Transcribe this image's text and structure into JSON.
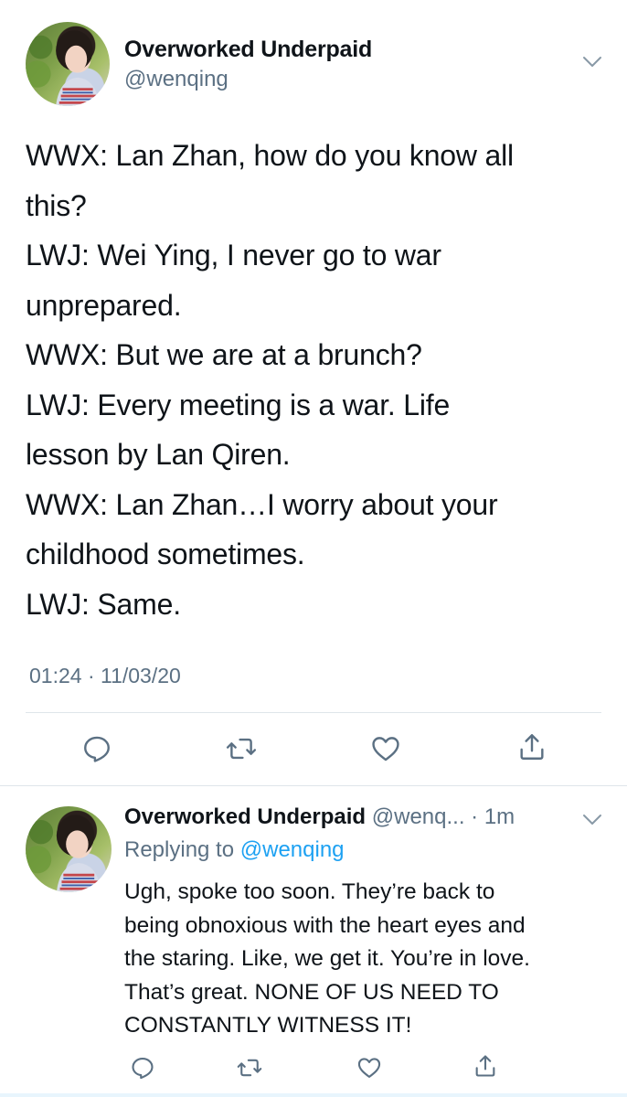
{
  "main_tweet": {
    "author_name": "Overworked Underpaid",
    "author_handle": "@wenqing",
    "body_lines": [
      "WWX: Lan Zhan, how do you know all",
      "this?",
      "LWJ: Wei Ying, I never go to war",
      "unprepared.",
      "WWX: But we are at a brunch?",
      "LWJ: Every meeting is a war. Life",
      "lesson by Lan Qiren.",
      "WWX: Lan Zhan…I worry about your",
      "childhood sometimes.",
      "LWJ: Same."
    ],
    "timestamp": "01:24 · 11/03/20"
  },
  "reply_tweet": {
    "author_name": "Overworked Underpaid",
    "meta": " @wenq... · 1m",
    "replying_to_prefix": "Replying to ",
    "replying_to_handle": "@wenqing",
    "body_lines": [
      "Ugh, spoke too soon. They’re back to",
      "being obnoxious with the heart eyes and",
      "the staring. Like, we get it. You’re in love.",
      "That’s great. NONE OF US NEED TO",
      "CONSTANTLY WITNESS IT!"
    ]
  },
  "icons": {
    "reply": "reply-icon",
    "retweet": "retweet-icon",
    "like": "heart-icon",
    "share": "share-icon",
    "more": "chevron-down-icon"
  },
  "colors": {
    "text": "#0f1419",
    "secondary": "#5b7083",
    "link": "#1da1f2",
    "divider": "#dfe5ea"
  }
}
